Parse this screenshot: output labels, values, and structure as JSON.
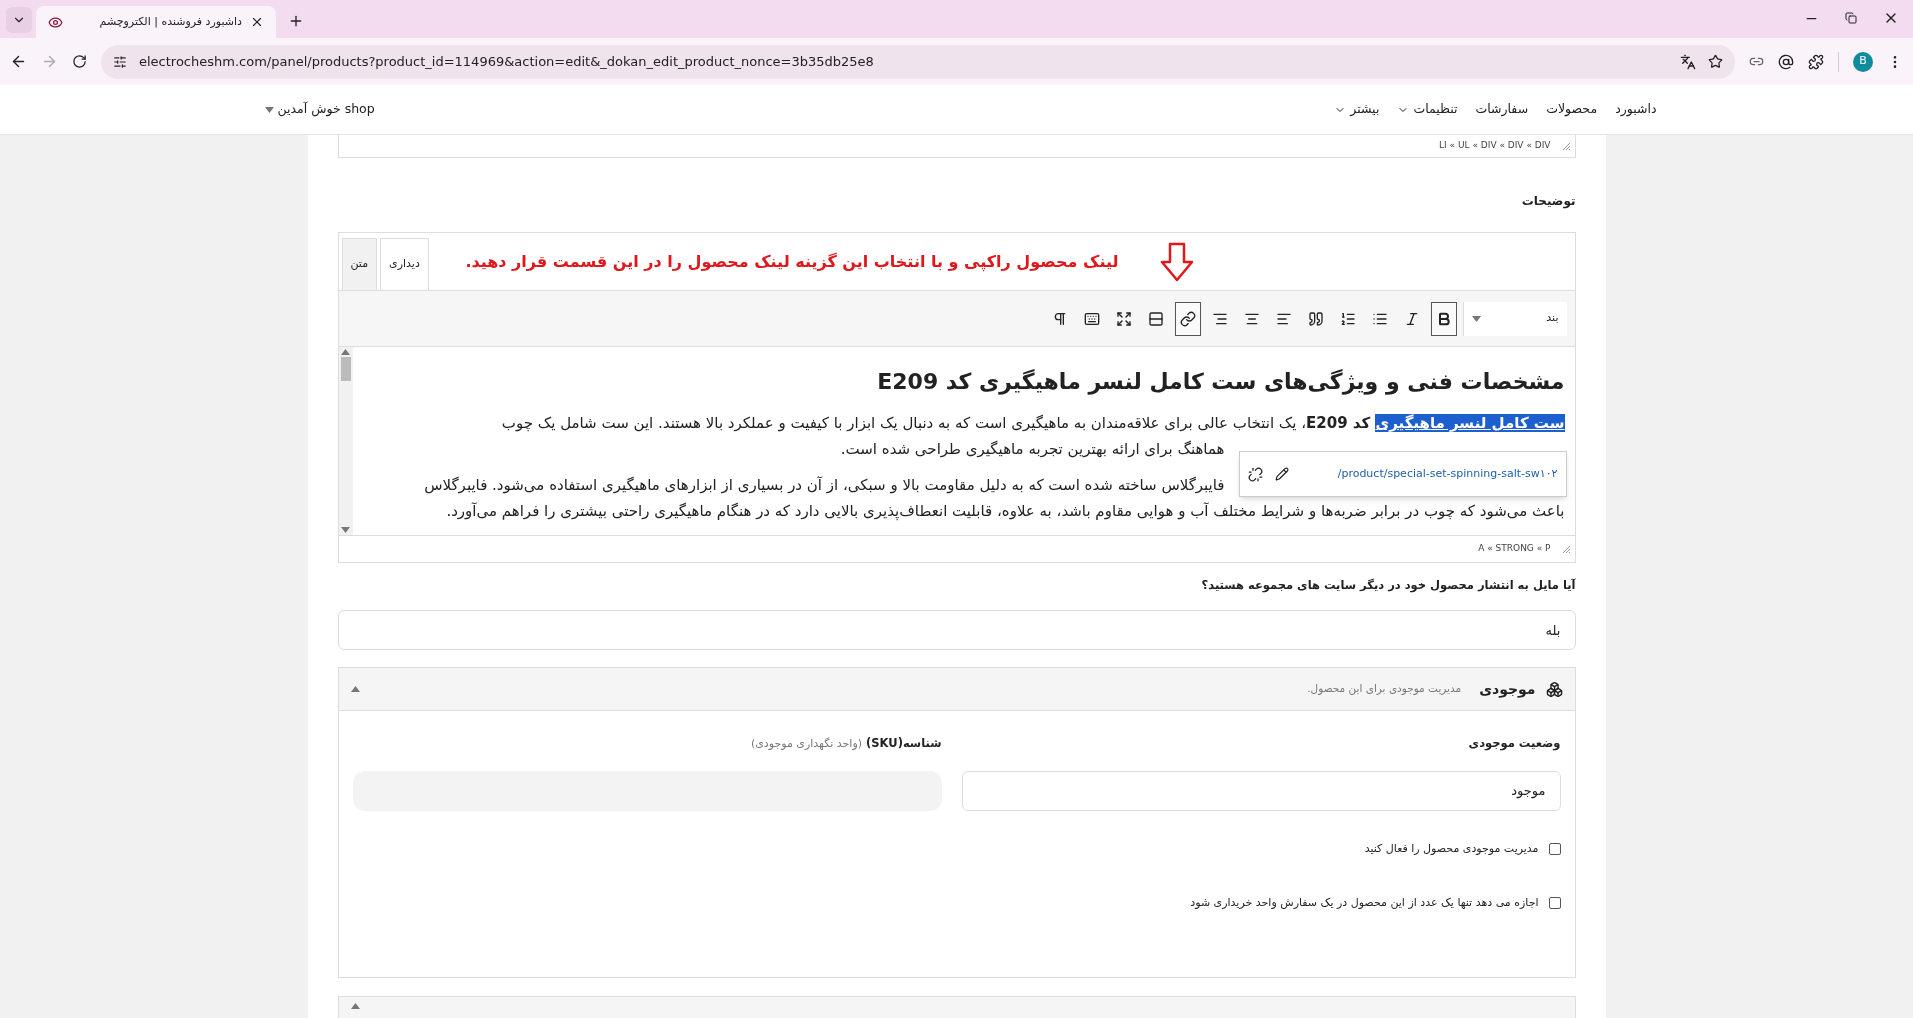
{
  "browser": {
    "tab_title": "داشبورد فروشنده | الکتروچشم",
    "address": "electrocheshm.com/panel/products?product_id=114969&action=edit&_dokan_edit_product_nonce=3b35db25e8",
    "profile_initial": "B"
  },
  "nav": {
    "items": [
      {
        "label": "داشبورد",
        "has_menu": false
      },
      {
        "label": "محصولات",
        "has_menu": false
      },
      {
        "label": "سفارشات",
        "has_menu": false
      },
      {
        "label": "تنظیمات",
        "has_menu": true
      },
      {
        "label": "بیشتر",
        "has_menu": true
      }
    ],
    "user_menu": "shop خوش آمدین"
  },
  "prev_editor": {
    "path": "LI « UL « DIV « DIV « DIV"
  },
  "description": {
    "label": "توضیحات",
    "tabs": [
      {
        "label": "دیداری",
        "selected": true
      },
      {
        "label": "متن",
        "selected": false
      }
    ],
    "annotation": "لینک محصول راکپی و با انتخاب این گزینه لینک محصول را در این قسمت قرار دهید.",
    "format": "بند",
    "toolbar": [
      {
        "kind": "bold",
        "active": true
      },
      {
        "kind": "italic",
        "active": false
      },
      {
        "kind": "bullets",
        "active": false
      },
      {
        "kind": "numbers",
        "active": false
      },
      {
        "kind": "quote",
        "active": false
      },
      {
        "kind": "align_left",
        "active": false
      },
      {
        "kind": "align_center",
        "active": false
      },
      {
        "kind": "align_right",
        "active": false
      },
      {
        "kind": "link",
        "active": true
      },
      {
        "kind": "more",
        "active": false
      },
      {
        "kind": "fullscreen",
        "active": false
      },
      {
        "kind": "keyboard",
        "active": false
      },
      {
        "kind": "direction",
        "active": false
      }
    ],
    "heading": "مشخصات فنی و ویژگی‌های ست کامل لنسر ماهیگیری کد E209",
    "paragraphs": [
      {
        "lines": [
          {
            "covered": false,
            "segments": [
              {
                "kind": "link",
                "text": "ست کامل لنسر ماهیگیری",
                "selected": true
              },
              {
                "kind": "bold",
                "text": " کد E209"
              },
              {
                "kind": "plain",
                "text": "، یک انتخاب عالی برای علاقه‌مندان به ماهیگیری است که به دنبال یک ابزار با کیفیت و عملکرد بالا هستند. این ست شامل یک چوب"
              }
            ]
          },
          {
            "covered": true,
            "segments": [
              {
                "kind": "plain",
                "text": "هماهنگ برای ارائه بهترین تجربه ماهیگیری طراحی شده است."
              }
            ]
          }
        ]
      },
      {
        "lines": [
          {
            "covered": true,
            "segments": [
              {
                "kind": "plain",
                "text": "فایبرگلاس ساخته شده است که به دلیل مقاومت بالا و سبکی، از آن در بسیاری از ابزارهای ماهیگیری استفاده می‌شود. فایبرگلاس"
              }
            ]
          },
          {
            "covered": false,
            "segments": [
              {
                "kind": "plain",
                "text": "باعث می‌شود که چوب در برابر ضربه‌ها و شرایط مختلف آب و هوایی مقاوم باشد، به علاوه، قابلیت انعطاف‌پذیری بالایی دارد که در هنگام ماهیگیری راحتی بیشتری را فراهم می‌آورد."
              }
            ]
          }
        ]
      }
    ],
    "link_popup": {
      "url": "/product/special-set-spinning-salt-sw۱۰۲"
    },
    "path": "A « STRONG « P"
  },
  "publish": {
    "question": "آیا مایل به انتشار محصول خود در دیگر سایت های مجموعه هستید؟",
    "value": "بله"
  },
  "inventory": {
    "title": "موجودی",
    "subtitle": "مدیریت موجودی برای این محصول.",
    "expanded": true,
    "stock_label": "وضعیت موجودی",
    "stock_value": "موجود",
    "sku_label": "شناسه(SKU)",
    "sku_hint": "(واحد نگهداری موجودی)",
    "sku_disabled": true,
    "options": [
      {
        "label": "مدیریت موجودی محصول را فعال کنید",
        "checked": false
      },
      {
        "label": "اجازه می دهد تنها یک عدد از این محصول در یک سفارش واحد خریداری شود",
        "checked": false
      }
    ]
  }
}
